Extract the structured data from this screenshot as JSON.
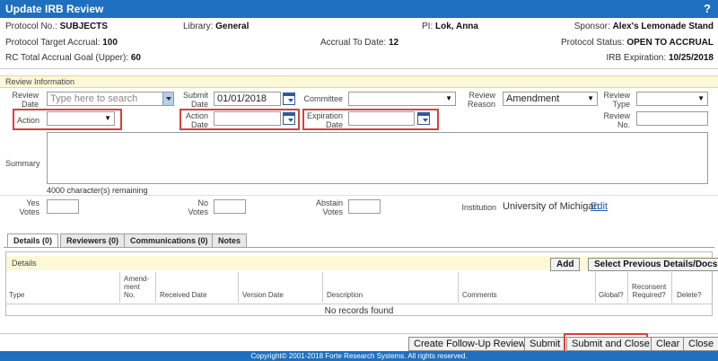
{
  "window": {
    "title": "Update IRB Review",
    "help": "?"
  },
  "header": {
    "protocol_no_label": "Protocol No.:",
    "protocol_no": "SUBJECTS",
    "library_label": "Library:",
    "library": "General",
    "pi_label": "PI:",
    "pi": "Lok, Anna",
    "sponsor_label": "Sponsor:",
    "sponsor": "Alex's Lemonade Stand",
    "target_accrual_label": "Protocol Target Accrual:",
    "target_accrual": "100",
    "accrual_to_date_label": "Accrual To Date:",
    "accrual_to_date": "12",
    "status_label": "Protocol Status:",
    "status": "OPEN TO ACCRUAL",
    "goal_label": "RC Total Accrual Goal (Upper):",
    "goal": "60",
    "irb_exp_label": "IRB Expiration:",
    "irb_exp": "10/25/2018"
  },
  "review": {
    "section_title": "Review Information",
    "review_date_label": [
      "Review",
      "Date"
    ],
    "review_date_placeholder": "Type here to search",
    "submit_date_label": [
      "Submit",
      "Date"
    ],
    "submit_date_value": "01/01/2018",
    "committee_label": "Committee",
    "review_reason_label": [
      "Review",
      "Reason"
    ],
    "review_reason_value": "Amendment",
    "review_type_label": [
      "Review",
      "Type"
    ],
    "action_label": "Action",
    "action_date_label": [
      "Action",
      "Date"
    ],
    "expiration_date_label": [
      "Expiration",
      "Date"
    ],
    "review_no_label": [
      "Review",
      "No."
    ],
    "summary_label": "Summary",
    "chars_remaining": "4000 character(s) remaining",
    "yes_votes_label": [
      "Yes",
      "Votes"
    ],
    "no_votes_label": [
      "No",
      "Votes"
    ],
    "abstain_votes_label": [
      "Abstain",
      "Votes"
    ],
    "institution_label": "Institution",
    "institution_value": "University of Michigan",
    "edit_link": "Edit"
  },
  "tabs": [
    {
      "label": "Details (0)"
    },
    {
      "label": "Reviewers (0)"
    },
    {
      "label": "Communications (0)"
    },
    {
      "label": "Notes"
    }
  ],
  "details": {
    "title": "Details",
    "add_button": "Add",
    "select_prev_button": "Select Previous Details/Docs",
    "columns": {
      "type": "Type",
      "amendment_no": [
        "Amend-",
        "ment",
        "No."
      ],
      "received_date": "Received Date",
      "version_date": "Version Date",
      "description": "Description",
      "comments": "Comments",
      "global": "Global?",
      "reconsent": [
        "Reconsent",
        "Required?"
      ],
      "delete": "Delete?"
    },
    "empty_text": "No records found"
  },
  "actions": {
    "followup": "Create Follow-Up Review",
    "submit": "Submit",
    "submit_close": "Submit and Close",
    "clear": "Clear",
    "close": "Close"
  },
  "footer": {
    "copyright": "Copyright© 2001-2018 Forte Research Systems. All rights reserved."
  }
}
